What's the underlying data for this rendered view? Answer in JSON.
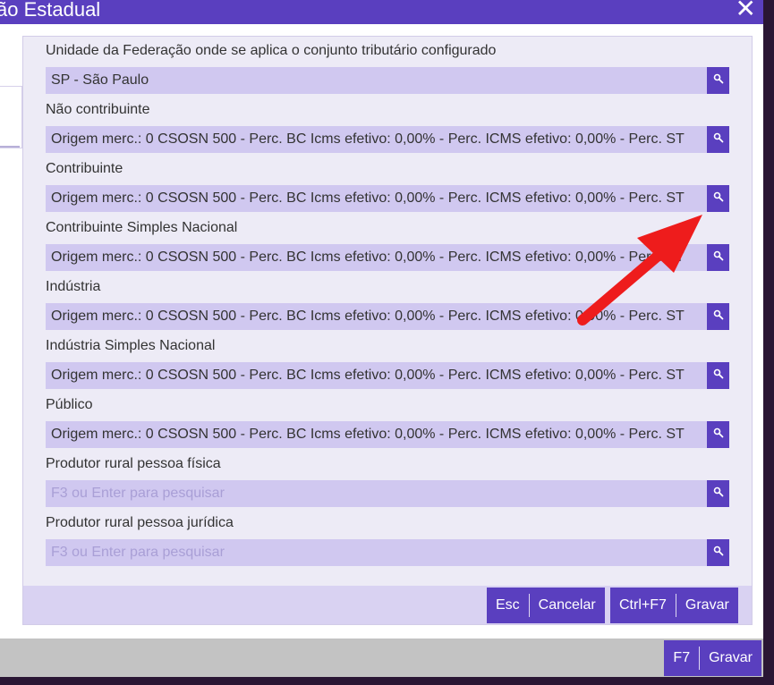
{
  "window": {
    "title": "ão Estadual",
    "close_label": "✕"
  },
  "fields": [
    {
      "label": "Unidade da Federação onde se aplica o conjunto tributário configurado",
      "value": "SP - São Paulo",
      "placeholder": false
    },
    {
      "label": "Não contribuinte",
      "value": "Origem merc.: 0 CSOSN 500 - Perc. BC Icms efetivo: 0,00% - Perc. ICMS efetivo: 0,00% - Perc. ST",
      "placeholder": false
    },
    {
      "label": "Contribuinte",
      "value": "Origem merc.: 0 CSOSN 500 - Perc. BC Icms efetivo: 0,00% - Perc. ICMS efetivo: 0,00% - Perc. ST",
      "placeholder": false
    },
    {
      "label": "Contribuinte Simples Nacional",
      "value": "Origem merc.: 0 CSOSN 500 - Perc. BC Icms efetivo: 0,00% - Perc. ICMS efetivo: 0,00% - Perc. ST",
      "placeholder": false
    },
    {
      "label": "Indústria",
      "value": "Origem merc.: 0 CSOSN 500 - Perc. BC Icms efetivo: 0,00% - Perc. ICMS efetivo: 0,00% - Perc. ST",
      "placeholder": false
    },
    {
      "label": "Indústria Simples Nacional",
      "value": "Origem merc.: 0 CSOSN 500 - Perc. BC Icms efetivo: 0,00% - Perc. ICMS efetivo: 0,00% - Perc. ST",
      "placeholder": false
    },
    {
      "label": "Público",
      "value": "Origem merc.: 0 CSOSN 500 - Perc. BC Icms efetivo: 0,00% - Perc. ICMS efetivo: 0,00% - Perc. ST",
      "placeholder": false
    },
    {
      "label": "Produtor rural pessoa física",
      "value": "F3 ou Enter para pesquisar",
      "placeholder": true
    },
    {
      "label": "Produtor rural pessoa jurídica",
      "value": "F3 ou Enter para pesquisar",
      "placeholder": true
    }
  ],
  "search_icon": "search-icon",
  "footer": {
    "cancel_key": "Esc",
    "cancel_label": "Cancelar",
    "save_key": "Ctrl+F7",
    "save_label": "Gravar"
  },
  "outer_footer": {
    "save_key": "F7",
    "save_label": "Gravar"
  },
  "colors": {
    "accent": "#5a3fbf",
    "field_bg": "#d0c8f0",
    "annotation": "#ee1c1c"
  }
}
